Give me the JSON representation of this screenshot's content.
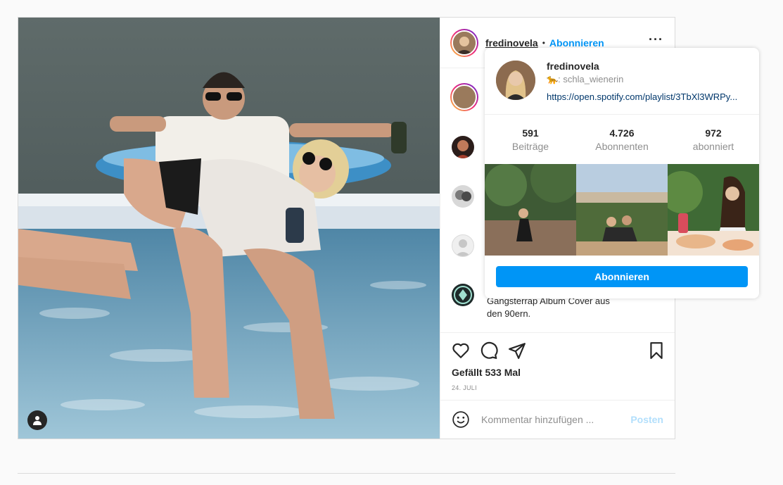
{
  "post": {
    "username": "fredinovela",
    "separator": "•",
    "follow_label": "Abonnieren",
    "more_icon": "more-horizontal-icon",
    "caption_lines": [
      "Gangsterrap Album Cover aus",
      "den 90ern."
    ],
    "likes_text": "Gefällt 533 Mal",
    "date_text": "24. JULI",
    "comment_placeholder": "Kommentar hinzufügen ...",
    "post_button_label": "Posten"
  },
  "hover_card": {
    "username": "fredinovela",
    "subtitle": "🐆: schla_wienerin",
    "link": "https://open.spotify.com/playlist/3TbXl3WRPy...",
    "stats": [
      {
        "value": "591",
        "label": "Beiträge"
      },
      {
        "value": "4.726",
        "label": "Abonnenten"
      },
      {
        "value": "972",
        "label": "abonniert"
      }
    ],
    "follow_label": "Abonnieren"
  },
  "colors": {
    "accent": "#0095f6",
    "border": "#dbdbdb",
    "muted_text": "#8e8e8e",
    "background": "#fafafa"
  }
}
